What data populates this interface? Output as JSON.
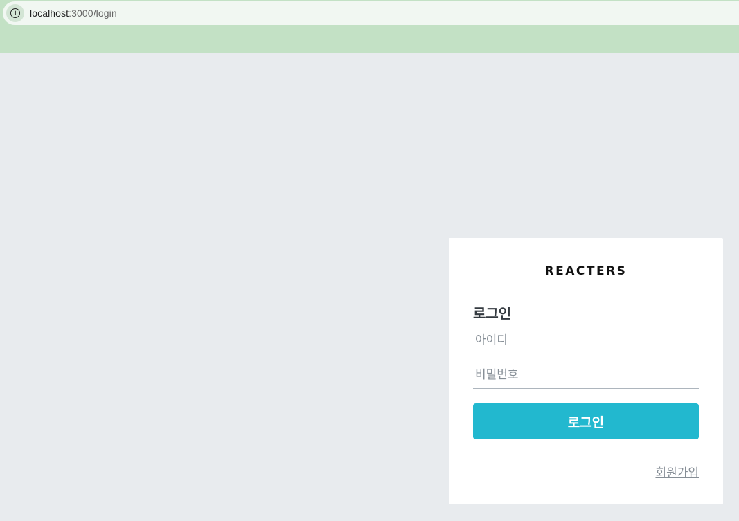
{
  "browser": {
    "url_host": "localhost",
    "url_path": ":3000/login",
    "site_info_icon": "info-icon"
  },
  "login": {
    "brand": "REACTERS",
    "title": "로그인",
    "username_placeholder": "아이디",
    "password_placeholder": "비밀번호",
    "submit_label": "로그인",
    "signup_label": "회원가입"
  },
  "colors": {
    "accent": "#22b8cf",
    "background": "#e8ebee",
    "chrome": "#c3e1c5"
  }
}
